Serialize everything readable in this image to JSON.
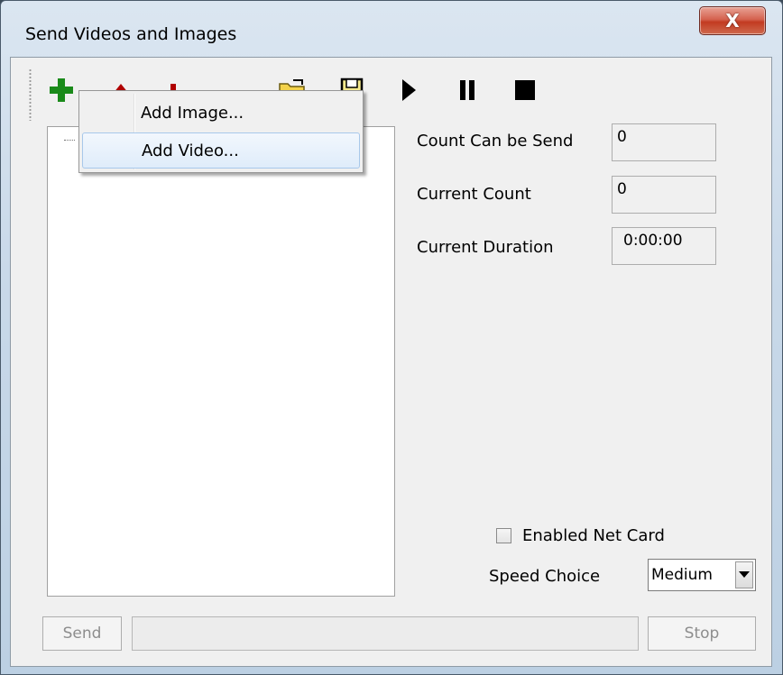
{
  "window": {
    "title": "Send Videos and Images",
    "close_label": "X"
  },
  "toolbar": {
    "buttons": [
      {
        "icon": "add-icon",
        "color": "#1a8a1a"
      },
      {
        "icon": "move-up-icon",
        "color": "#b00000"
      },
      {
        "icon": "move-down-icon",
        "color": "#b00000"
      },
      {
        "icon": "delete-icon",
        "color": "#b00000"
      },
      {
        "icon": "open-folder-icon",
        "color": "#e6b800"
      },
      {
        "icon": "save-icon",
        "color": "#000000"
      },
      {
        "icon": "play-icon",
        "color": "#000000"
      },
      {
        "icon": "pause-icon",
        "color": "#000000"
      },
      {
        "icon": "stop-icon",
        "color": "#000000"
      }
    ]
  },
  "context_menu": {
    "items": [
      {
        "label": "Add Image..."
      },
      {
        "label": "Add Video..."
      }
    ]
  },
  "stats": {
    "count_can_be_send_label": "Count Can be Send",
    "count_can_be_send_value": "0",
    "current_count_label": "Current Count",
    "current_count_value": "0",
    "current_duration_label": "Current Duration",
    "current_duration_value": "0:00:00"
  },
  "options": {
    "enabled_net_card_label": "Enabled Net Card",
    "enabled_net_card_checked": false,
    "speed_choice_label": "Speed Choice",
    "speed_choice_value": "Medium"
  },
  "footer": {
    "send_label": "Send",
    "stop_label": "Stop",
    "progress": 0
  }
}
